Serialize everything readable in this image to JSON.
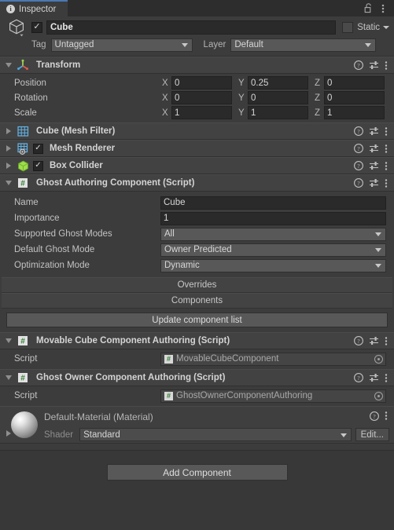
{
  "window": {
    "tab_label": "Inspector",
    "tab_icon": "info-icon",
    "lock_icon": "padlock-unlocked-icon",
    "menu_icon": "kebab-menu-icon"
  },
  "gameobject": {
    "icon": "cube-outline-icon",
    "enabled": true,
    "name": "Cube",
    "static_label": "Static",
    "static_checked": false,
    "tag_label": "Tag",
    "tag_value": "Untagged",
    "layer_label": "Layer",
    "layer_value": "Default"
  },
  "components": [
    {
      "id": "transform",
      "title": "Transform",
      "icon": "transform-axis-icon",
      "expanded": true,
      "has_checkbox": false,
      "rows": [
        {
          "label": "Position",
          "x": "0",
          "y": "0.25",
          "z": "0"
        },
        {
          "label": "Rotation",
          "x": "0",
          "y": "0",
          "z": "0"
        },
        {
          "label": "Scale",
          "x": "1",
          "y": "1",
          "z": "1"
        }
      ],
      "axis_labels": [
        "X",
        "Y",
        "Z"
      ]
    },
    {
      "id": "mesh-filter",
      "title": "Cube (Mesh Filter)",
      "icon": "mesh-filter-icon",
      "expanded": false,
      "has_checkbox": false
    },
    {
      "id": "mesh-renderer",
      "title": "Mesh Renderer",
      "icon": "mesh-renderer-icon",
      "expanded": false,
      "has_checkbox": true,
      "checked": true
    },
    {
      "id": "box-collider",
      "title": "Box Collider",
      "icon": "box-collider-icon",
      "expanded": false,
      "has_checkbox": true,
      "checked": true
    },
    {
      "id": "ghost-authoring",
      "title": "Ghost Authoring Component (Script)",
      "icon": "script-icon",
      "expanded": true,
      "has_checkbox": false
    },
    {
      "id": "movable-cube",
      "title": "Movable Cube Component Authoring (Script)",
      "icon": "script-icon",
      "expanded": true,
      "has_checkbox": false
    },
    {
      "id": "ghost-owner",
      "title": "Ghost Owner Component Authoring (Script)",
      "icon": "script-icon",
      "expanded": true,
      "has_checkbox": false
    }
  ],
  "ghost_authoring": {
    "fields": [
      {
        "label": "Name",
        "value": "Cube",
        "type": "text"
      },
      {
        "label": "Importance",
        "value": "1",
        "type": "text"
      },
      {
        "label": "Supported Ghost Modes",
        "value": "All",
        "type": "dropdown"
      },
      {
        "label": "Default Ghost Mode",
        "value": "Owner Predicted",
        "type": "dropdown"
      },
      {
        "label": "Optimization Mode",
        "value": "Dynamic",
        "type": "dropdown"
      }
    ],
    "overrides_label": "Overrides",
    "components_label": "Components",
    "update_button": "Update component list"
  },
  "movable_cube": {
    "script_label": "Script",
    "script_value": "MovableCubeComponent"
  },
  "ghost_owner": {
    "script_label": "Script",
    "script_value": "GhostOwnerComponentAuthoring"
  },
  "material": {
    "title": "Default-Material (Material)",
    "shader_label": "Shader",
    "shader_value": "Standard",
    "edit_label": "Edit...",
    "help_icon": "help-icon",
    "menu_icon": "kebab-menu-icon"
  },
  "footer": {
    "add_component_label": "Add Component"
  },
  "header_icons": {
    "help": "help-icon",
    "preset": "preset-sliders-icon",
    "menu": "kebab-menu-icon"
  },
  "colors": {
    "accent_tab": "#4a78b4",
    "panel_bg": "#383838",
    "header_bg": "#424242",
    "body_bg": "#3c3c3c",
    "field_dark": "#2a2a2a",
    "popup_gray": "#585858"
  }
}
